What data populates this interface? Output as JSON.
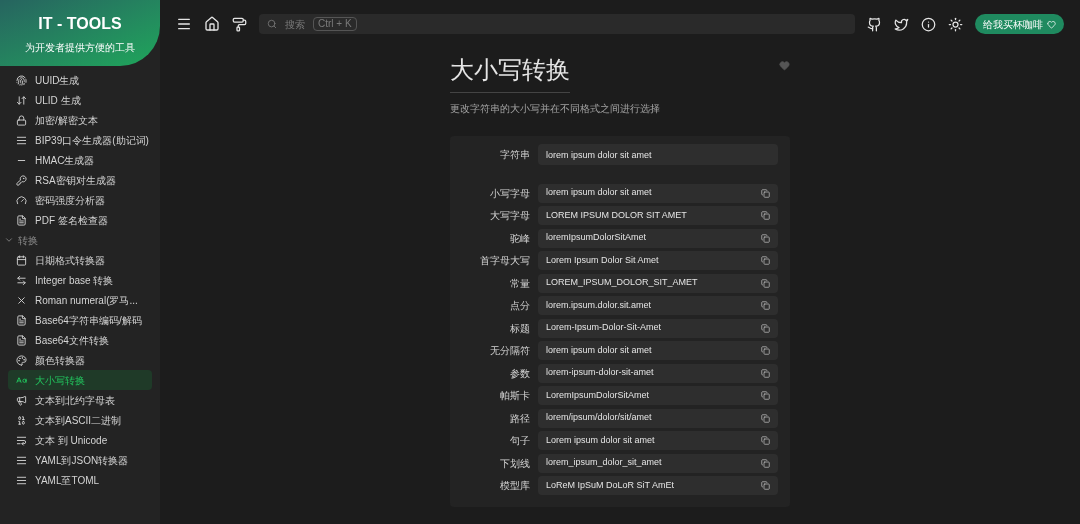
{
  "sidebar": {
    "header": {
      "title": "IT - TOOLS",
      "subtitle": "为开发者提供方便的工具"
    },
    "items": [
      {
        "label": "UUID生成",
        "selected": false
      },
      {
        "label": "ULID 生成",
        "selected": false
      },
      {
        "label": "加密/解密文本",
        "selected": false
      },
      {
        "label": "BIP39口令生成器(助记词)",
        "selected": false
      },
      {
        "label": "HMAC生成器",
        "selected": false
      },
      {
        "label": "RSA密钥对生成器",
        "selected": false
      },
      {
        "label": "密码强度分析器",
        "selected": false
      },
      {
        "label": "PDF 签名检查器",
        "selected": false
      }
    ],
    "groups": [
      {
        "label": "转换",
        "expanded": true,
        "items": [
          {
            "label": "日期格式转换器",
            "selected": false
          },
          {
            "label": "Integer base 转换",
            "selected": false
          },
          {
            "label": "Roman numeral(罗马...",
            "selected": false
          },
          {
            "label": "Base64字符串编码/解码",
            "selected": false
          },
          {
            "label": "Base64文件转换",
            "selected": false
          },
          {
            "label": "颜色转换器",
            "selected": false
          },
          {
            "label": "大小写转换",
            "selected": true
          },
          {
            "label": "文本到北约字母表",
            "selected": false
          },
          {
            "label": "文本到ASCII二进制",
            "selected": false
          },
          {
            "label": "文本 到 Unicode",
            "selected": false
          },
          {
            "label": "YAML到JSON转换器",
            "selected": false
          },
          {
            "label": "YAML至TOML",
            "selected": false
          }
        ]
      }
    ]
  },
  "topbar": {
    "search": {
      "label": "搜索",
      "shortcut": "Ctrl + K"
    },
    "coffee_button": "给我买杯咖啡"
  },
  "tool": {
    "title": "大小写转换",
    "favorite": false,
    "description": "更改字符串的大小写并在不同格式之间进行选择",
    "input": {
      "label": "字符串",
      "value": "lorem ipsum dolor sit amet"
    },
    "outputs": [
      {
        "label": "小写字母",
        "value": "lorem ipsum dolor sit amet"
      },
      {
        "label": "大写字母",
        "value": "LOREM IPSUM DOLOR SIT AMET"
      },
      {
        "label": "驼峰",
        "value": "loremIpsumDolorSitAmet"
      },
      {
        "label": "首字母大写",
        "value": "Lorem Ipsum Dolor Sit Amet"
      },
      {
        "label": "常量",
        "value": "LOREM_IPSUM_DOLOR_SIT_AMET"
      },
      {
        "label": "点分",
        "value": "lorem.ipsum.dolor.sit.amet"
      },
      {
        "label": "标题",
        "value": "Lorem-Ipsum-Dolor-Sit-Amet"
      },
      {
        "label": "无分隔符",
        "value": "lorem ipsum dolor sit amet"
      },
      {
        "label": "参数",
        "value": "lorem-ipsum-dolor-sit-amet"
      },
      {
        "label": "帕斯卡",
        "value": "LoremIpsumDolorSitAmet"
      },
      {
        "label": "路径",
        "value": "lorem/ipsum/dolor/sit/amet"
      },
      {
        "label": "句子",
        "value": "Lorem ipsum dolor sit amet"
      },
      {
        "label": "下划线",
        "value": "lorem_ipsum_dolor_sit_amet"
      },
      {
        "label": "模型库",
        "value": "LoReM IpSuM DoLoR SiT AmEt"
      }
    ]
  }
}
